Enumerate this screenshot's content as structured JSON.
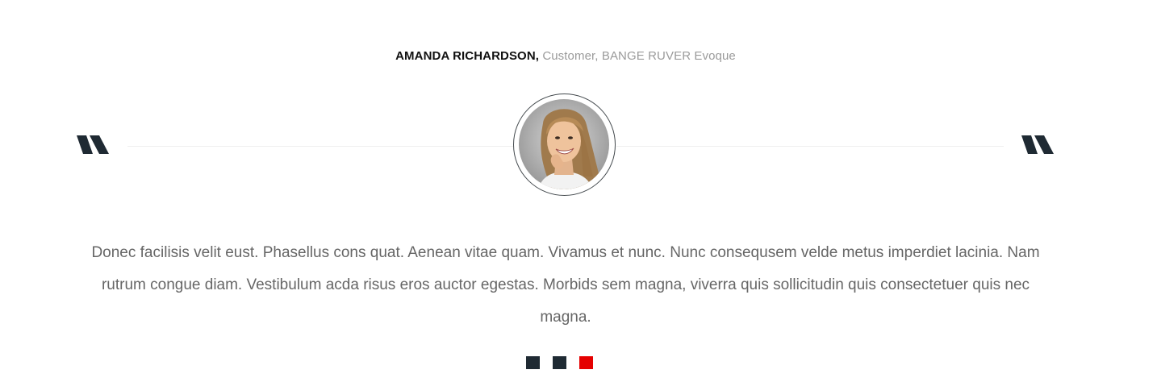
{
  "testimonial": {
    "author_name": "AMANDA RICHARDSON,",
    "author_role": "Customer, BANGE RUVER Evoque",
    "text": "Donec facilisis velit eust. Phasellus cons quat. Aenean vitae quam. Vivamus et nunc. Nunc consequsem velde metus imperdiet lacinia. Nam rutrum congue diam. Vestibulum acda risus eros auctor egestas. Morbids sem magna, viverra quis sollicitudin quis consectetuer quis nec magna."
  },
  "icons": {
    "left_quote": "quote-open-icon",
    "right_quote": "quote-close-icon"
  },
  "pagination": {
    "count": 3,
    "active_index": 2
  },
  "colors": {
    "quote_mark": "#1f2a33",
    "dot": "#1f2a33",
    "dot_active": "#e50000",
    "name": "#111111",
    "role": "#9a9a9a",
    "body_text": "#666666"
  }
}
